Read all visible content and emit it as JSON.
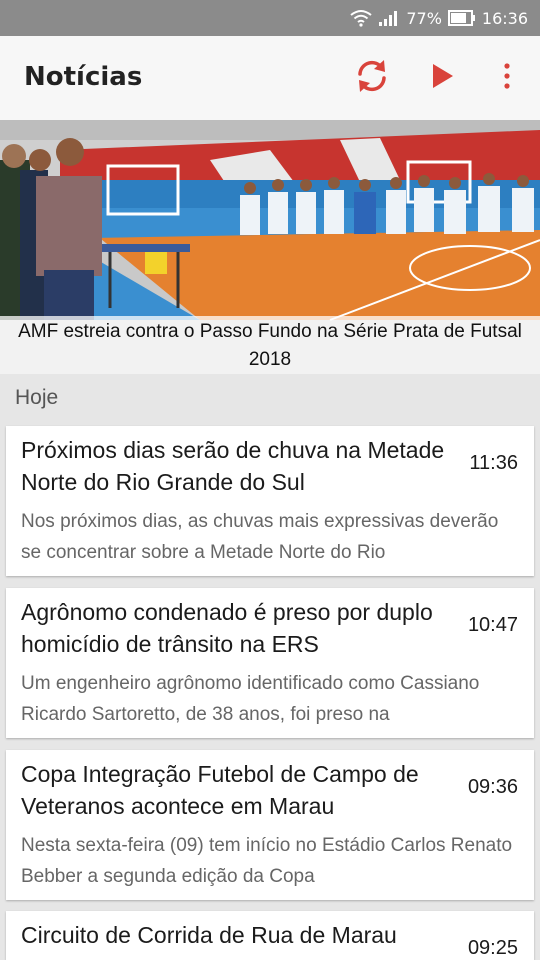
{
  "status_bar": {
    "battery_percent": "77%",
    "time": "16:36",
    "icons": [
      "wifi-icon",
      "signal-icon",
      "battery-icon"
    ]
  },
  "app_bar": {
    "title": "Notícias",
    "actions": [
      "refresh-icon",
      "play-icon",
      "more-vert-icon"
    ],
    "accent_color": "#d9433b"
  },
  "featured": {
    "caption": "AMF estreia contra o Passo Fundo na Série Prata de Futsal 2018"
  },
  "section_label": "Hoje",
  "news": [
    {
      "title": "Próximos dias serão de chuva na Metade Norte do Rio Grande do Sul",
      "time": "11:36",
      "summary": "Nos próximos dias, as chuvas mais expressivas deverão se concentrar sobre a Metade Norte do Rio"
    },
    {
      "title": "Agrônomo condenado é preso por duplo homicídio de trânsito na ERS",
      "time": "10:47",
      "summary": "Um engenheiro agrônomo identificado como Cassiano Ricardo Sartoretto, de 38 anos, foi preso na"
    },
    {
      "title": "Copa Integração Futebol de Campo de Veteranos acontece em Marau",
      "time": "09:36",
      "summary": "Nesta sexta-feira (09) tem início no Estádio Carlos Renato Bebber a segunda edição da Copa"
    },
    {
      "title": "Circuito de Corrida de Rua de Marau",
      "time": "09:25",
      "summary": ""
    }
  ]
}
